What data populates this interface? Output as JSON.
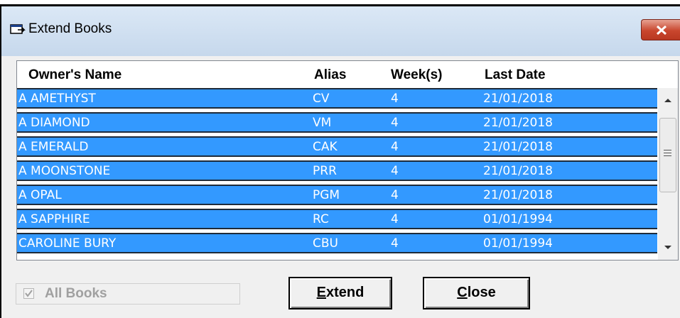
{
  "window": {
    "title": "Extend Books",
    "icon": "books-window-icon"
  },
  "table": {
    "columns": [
      "Owner's Name",
      "Alias",
      "Week(s)",
      "Last Date"
    ],
    "rows": [
      {
        "owner": "A AMETHYST",
        "alias": "CV",
        "weeks": "4",
        "last_date": "21/01/2018"
      },
      {
        "owner": "A DIAMOND",
        "alias": "VM",
        "weeks": "4",
        "last_date": "21/01/2018"
      },
      {
        "owner": "A EMERALD",
        "alias": "CAK",
        "weeks": "4",
        "last_date": "21/01/2018"
      },
      {
        "owner": "A MOONSTONE",
        "alias": "PRR",
        "weeks": "4",
        "last_date": "21/01/2018"
      },
      {
        "owner": "A OPAL",
        "alias": "PGM",
        "weeks": "4",
        "last_date": "21/01/2018"
      },
      {
        "owner": "A SAPPHIRE",
        "alias": "RC",
        "weeks": "4",
        "last_date": "01/01/1994"
      },
      {
        "owner": "CAROLINE BURY",
        "alias": "CBU",
        "weeks": "4",
        "last_date": "01/01/1994"
      }
    ],
    "selected_color": "#3399ff"
  },
  "controls": {
    "all_books_label": "All Books",
    "all_books_checked": true,
    "all_books_enabled": false,
    "extend_label_first": "E",
    "extend_label_rest": "xtend",
    "close_label_first": "C",
    "close_label_rest": "lose"
  }
}
